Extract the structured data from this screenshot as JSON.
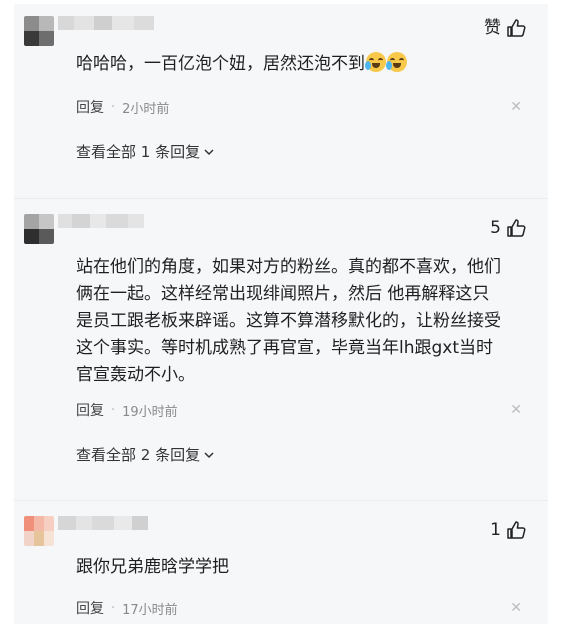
{
  "comments": [
    {
      "like_label": "赞",
      "text_main": "哈哈哈，一百亿泡个妞，居然还泡不到",
      "emoji_names": [
        "crying-laughing-icon",
        "crying-laughing-icon"
      ],
      "reply_label": "回复",
      "time": "2小时前",
      "expand_label": "查看全部 1 条回复"
    },
    {
      "like_count": "5",
      "text_lines": [
        "站在他们的角度，如果对方的粉丝。真的都不喜欢，他们",
        "俩在一起。这样经常出现绯闻照片，然后 他再解释这只",
        "是员工跟老板来辟谣。这算不算潜移默化的，让粉丝接受",
        "这个事实。等时机成熟了再官宣，毕竟当年lh跟gxt当时",
        "官宣轰动不小。"
      ],
      "reply_label": "回复",
      "time": "19小时前",
      "expand_label": "查看全部 2 条回复"
    },
    {
      "like_count": "1",
      "text_main": "跟你兄弟鹿晗学学把",
      "reply_label": "回复",
      "time": "17小时前"
    }
  ],
  "icons": {
    "like": "thumbs-up-icon",
    "close": "close-icon",
    "chevron": "chevron-down-icon"
  },
  "colors": {
    "panel_bg": "#f6f7f9",
    "meta_gray": "#8a8a8a"
  }
}
